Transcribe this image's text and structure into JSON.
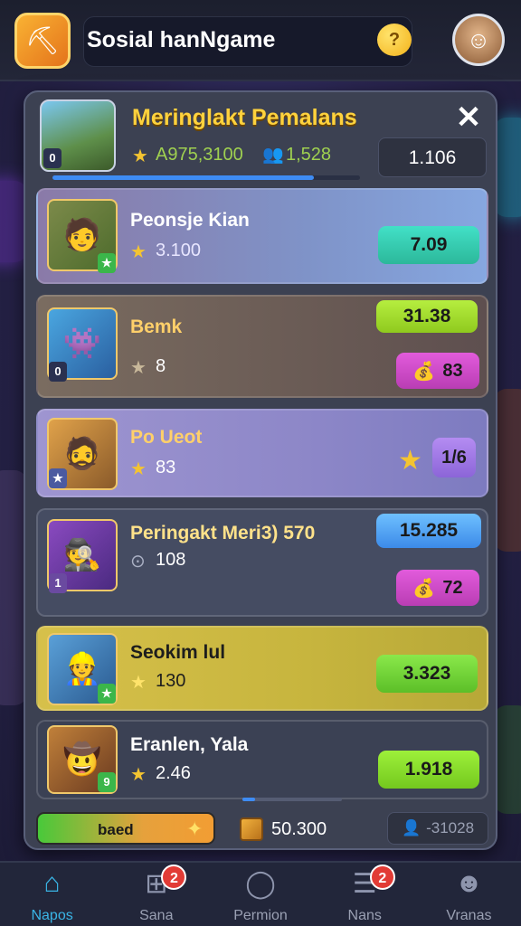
{
  "header": {
    "app_title": "Sosial hanNgame",
    "game_icon": "miner-hero-icon",
    "chat_icon": "chat-bubble-icon",
    "chat_glyph": "?",
    "avatar": "player-avatar"
  },
  "panel": {
    "title": "Meringlakt Pemalans",
    "thumb_badge": "0",
    "stat_points": "A975,3100",
    "stat_players": "1,528",
    "header_value": "1.106",
    "progress": 0.85
  },
  "rows": [
    {
      "name": "Peonsje Kian",
      "stat": "3.100",
      "score": "7.09",
      "score_color": "#3fd0b8",
      "row_color": "#7b86b8",
      "corner": "★"
    },
    {
      "name": "Bemk",
      "stat": "8",
      "score": "31.38",
      "score_color": "#a9e23a",
      "chip": "83",
      "chip_color": "#d64fd0",
      "row_color": "#6b5a55",
      "corner": "0"
    },
    {
      "name": "Po Ueot",
      "stat": "83",
      "chip": "1/6",
      "chip_color": "#a27be6",
      "row_color": "#8e8ac6",
      "corner": "★"
    },
    {
      "name": "Peringakt Meri3) 570",
      "stat": "108",
      "score": "15.285",
      "score_color": "#5ab0f5",
      "chip": "72",
      "chip_color": "#d64fd0",
      "row_color": "#454c62",
      "corner": "1"
    },
    {
      "name": "Seokim lul",
      "stat": "130",
      "score": "3.323",
      "score_color": "#7ed33b",
      "row_color": "#c7b53e",
      "corner": "★"
    },
    {
      "name": "Eranlen, Yala",
      "stat": "2.46",
      "score": "1.918",
      "score_color": "#8cdd2f",
      "row_color": "#3b4154",
      "corner": "9"
    }
  ],
  "footer": {
    "bonus_label": "baed",
    "crate_value": "50.300",
    "rank_value": "-31028"
  },
  "nav": [
    {
      "label": "Napos",
      "icon": "home-icon",
      "glyph": "⌂",
      "active": true,
      "badge": ""
    },
    {
      "label": "Sana",
      "icon": "game-controller-icon",
      "glyph": "⊞",
      "active": false,
      "badge": "2"
    },
    {
      "label": "Permion",
      "icon": "chat-icon",
      "glyph": "◯",
      "active": false,
      "badge": ""
    },
    {
      "label": "Nans",
      "icon": "mail-icon",
      "glyph": "☰",
      "active": false,
      "badge": "2"
    },
    {
      "label": "Vranas",
      "icon": "profile-icon",
      "glyph": "☻",
      "active": false,
      "badge": ""
    }
  ]
}
